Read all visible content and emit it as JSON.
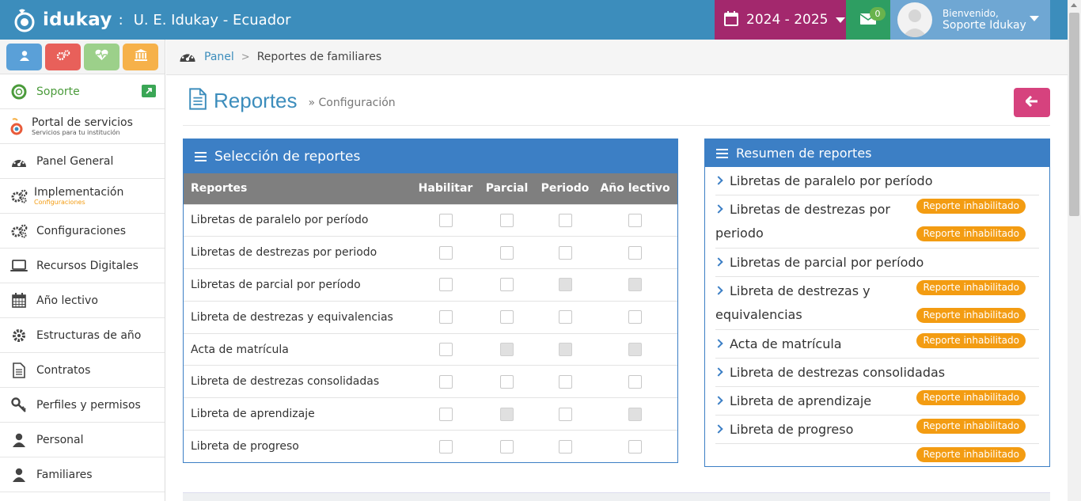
{
  "header": {
    "logo_text": "idukay",
    "separator": ":",
    "school_name": "U. E. Idukay - Ecuador",
    "year": "2024 - 2025",
    "mail_count": "0",
    "welcome": "Bienvenido,",
    "user_name": "Soporte Idukay"
  },
  "sidebar": {
    "quick_buttons": [
      {
        "icon": "user-icon",
        "color": "#5aa0d8"
      },
      {
        "icon": "gears-icon",
        "color": "#e8605a"
      },
      {
        "icon": "heartbeat-icon",
        "color": "#9cd08a"
      },
      {
        "icon": "bank-icon",
        "color": "#f6b14a"
      }
    ],
    "items": [
      {
        "label": "Soporte"
      },
      {
        "label": "Portal de servicios",
        "sub": "Servicios para tu institución"
      },
      {
        "label": "Panel General"
      },
      {
        "label": "Implementación",
        "sub": "Configuraciones"
      },
      {
        "label": "Configuraciones"
      },
      {
        "label": "Recursos Digitales"
      },
      {
        "label": "Año lectivo"
      },
      {
        "label": "Estructuras de año"
      },
      {
        "label": "Contratos"
      },
      {
        "label": "Perfiles y permisos"
      },
      {
        "label": "Personal"
      },
      {
        "label": "Familiares"
      }
    ]
  },
  "breadcrumb": {
    "panel": "Panel",
    "chevron": ">",
    "current": "Reportes de familiares"
  },
  "page": {
    "title": "Reportes",
    "subtitle": "» Configuración"
  },
  "selection": {
    "title": "Selección de reportes",
    "columns": [
      "Reportes",
      "Habilitar",
      "Parcial",
      "Periodo",
      "Año lectivo"
    ],
    "rows": [
      {
        "name": "Libretas de paralelo por período",
        "states": [
          "enabled",
          "enabled",
          "enabled",
          "enabled"
        ]
      },
      {
        "name": "Libretas de destrezas por periodo",
        "states": [
          "enabled",
          "enabled",
          "enabled",
          "enabled"
        ]
      },
      {
        "name": "Libretas de parcial por período",
        "states": [
          "enabled",
          "enabled",
          "disabled",
          "disabled"
        ]
      },
      {
        "name": "Libreta de destrezas y equivalencias",
        "states": [
          "enabled",
          "enabled",
          "enabled",
          "enabled"
        ]
      },
      {
        "name": "Acta de matrícula",
        "states": [
          "enabled",
          "disabled",
          "disabled",
          "disabled"
        ]
      },
      {
        "name": "Libreta de destrezas consolidadas",
        "states": [
          "enabled",
          "enabled",
          "enabled",
          "enabled"
        ]
      },
      {
        "name": "Libreta de aprendizaje",
        "states": [
          "enabled",
          "disabled",
          "enabled",
          "disabled"
        ]
      },
      {
        "name": "Libreta de progreso",
        "states": [
          "enabled",
          "enabled",
          "enabled",
          "enabled"
        ]
      }
    ]
  },
  "summary": {
    "title": "Resumen de reportes",
    "badge_text": "Reporte inhabilitado",
    "items": [
      {
        "line1": "Libretas de paralelo por período",
        "line2": "",
        "badges": 0
      },
      {
        "line1": "Libretas de destrezas por",
        "line2": "periodo",
        "badges": 2
      },
      {
        "line1": "Libretas de parcial por período",
        "line2": "",
        "badges": 0
      },
      {
        "line1": "Libreta de destrezas y",
        "line2": "equivalencias",
        "badges": 2
      },
      {
        "line1": "Acta de matrícula",
        "line2": "",
        "badges": 1
      },
      {
        "line1": "Libreta de destrezas consolidadas",
        "line2": "",
        "badges": 0
      },
      {
        "line1": "Libreta de aprendizaje",
        "line2": "",
        "badges": 1
      },
      {
        "line1": "Libreta de progreso",
        "line2": "",
        "badges": 2
      }
    ]
  }
}
